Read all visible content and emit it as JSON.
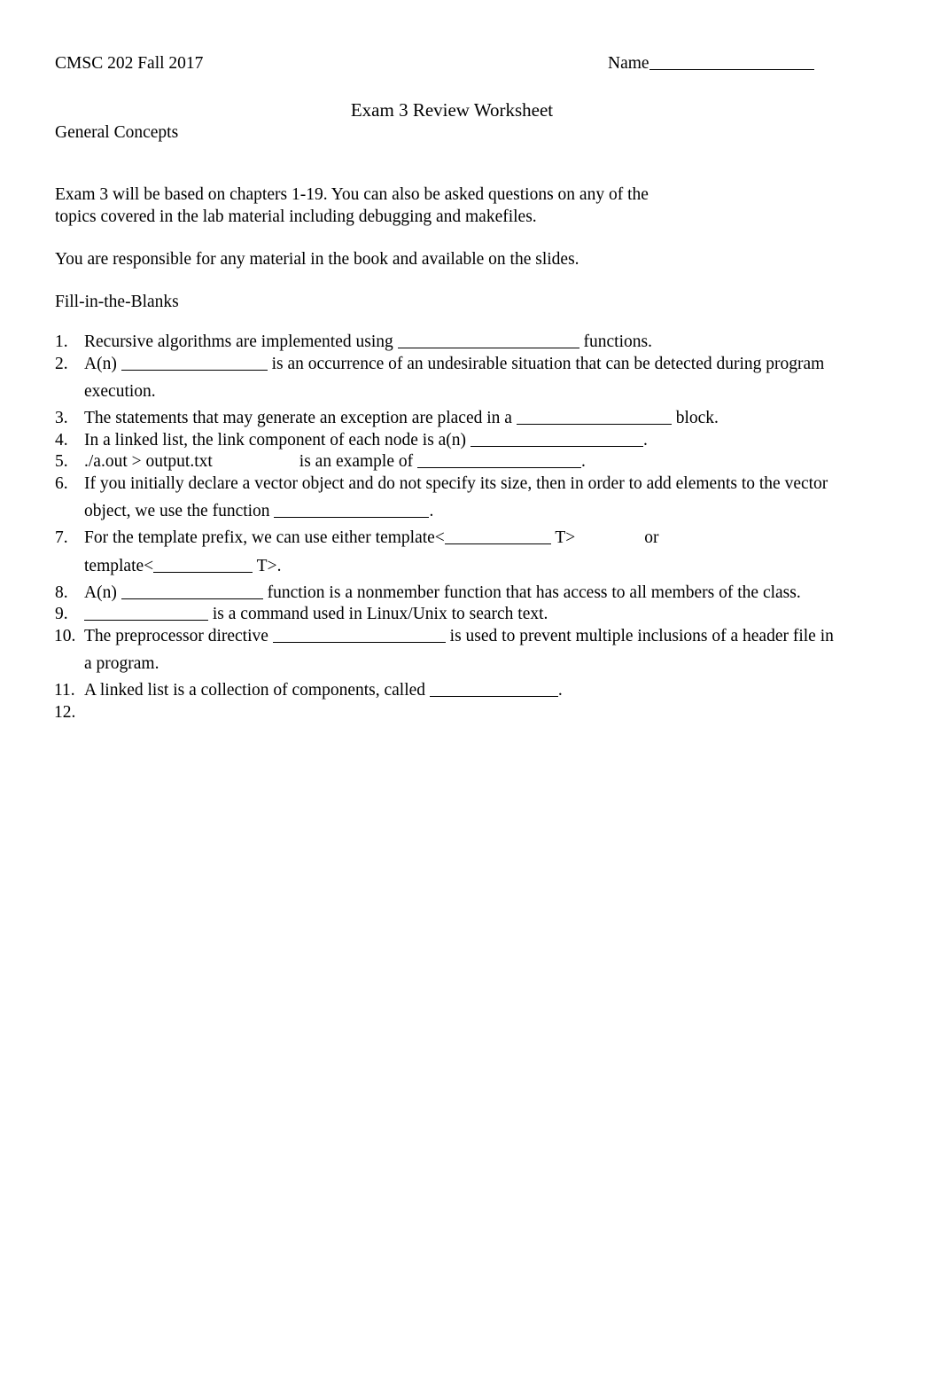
{
  "document": {
    "course": "CMSC 202 Fall 2017",
    "name_label": "Name",
    "title": "Exam 3 Review Worksheet",
    "section_heading": "General Concepts",
    "intro_paragraph": "Exam 3 will be based on chapters 1-19. You can also be asked questions on any of the\ntopics covered in the lab material including debugging and makefiles.",
    "responsibility_paragraph": "You are responsible for any material in the book and available on the slides.",
    "fill_in_heading": "Fill-in-the-Blanks"
  },
  "questions": [
    {
      "number": "1.",
      "before": "Recursive algorithms are implemented using ",
      "after": " functions."
    },
    {
      "number": "2.",
      "before": "A(n) ",
      "after": " is an occurrence of an undesirable situation that can be detected during program",
      "wrapped": "execution."
    },
    {
      "number": "3.",
      "before": "The statements that may generate an exception are placed in a ",
      "after": " block."
    },
    {
      "number": "4.",
      "before": "In a linked list, the link component of each node is a(n) ",
      "after": "."
    },
    {
      "number": "5.",
      "before": "./a.out > output.txt",
      "middle": "is an example of ",
      "after": "."
    },
    {
      "number": "6.",
      "before": "If you initially declare a vector object and do not specify its size, then in order to add elements to the vector",
      "wrapped_before": "object, we use the function ",
      "wrapped_after": "."
    },
    {
      "number": "7.",
      "before": "For the template prefix, we can use either template<",
      "middle": " T>",
      "after": "or",
      "wrapped_before": "template<",
      "wrapped_after": " T>."
    },
    {
      "number": "8.",
      "before": "A(n) ",
      "after": " function is a nonmember function that has access to all members of the class."
    },
    {
      "number": "9.",
      "before": "",
      "after": " is a command used in Linux/Unix to search text."
    },
    {
      "number": "10.",
      "before": "The preprocessor directive ",
      "after": " is used to prevent multiple inclusions of a header file in",
      "wrapped": "a program."
    },
    {
      "number": "11.",
      "before": "A linked list is a collection of components, called ",
      "after": "."
    },
    {
      "number": "12.",
      "before": "",
      "after": ""
    }
  ]
}
